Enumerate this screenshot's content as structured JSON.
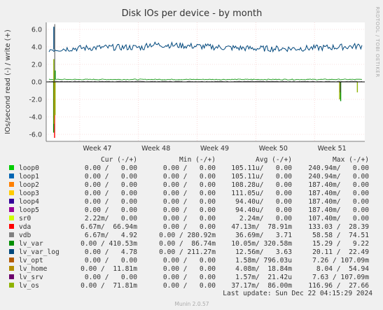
{
  "chart_data": {
    "type": "line",
    "title": "Disk IOs per device - by month",
    "ylabel": "IOs/second read (-) / write (+)",
    "xlabel": "",
    "ylim": [
      -6.8,
      6.8
    ],
    "yticks": [
      -6.0,
      -4.0,
      -2.0,
      0.0,
      2.0,
      4.0,
      6.0
    ],
    "ytick_labels": [
      "-6.0",
      "-4.0",
      "-2.0",
      "0.0",
      "2.0",
      "4.0",
      "6.0"
    ],
    "xlim": [
      "2024-11-14",
      "2024-12-22"
    ],
    "xticks": [
      {
        "label": "Week 47",
        "date": "2024-11-18"
      },
      {
        "label": "Week 48",
        "date": "2024-11-25"
      },
      {
        "label": "Week 49",
        "date": "2024-12-02"
      },
      {
        "label": "Week 50",
        "date": "2024-12-09"
      },
      {
        "label": "Week 51",
        "date": "2024-12-16"
      }
    ],
    "grid": true,
    "series": [
      {
        "name": "loop0",
        "color": "#00cc00",
        "approx_level": 0.0,
        "spikes": []
      },
      {
        "name": "loop1",
        "color": "#0066b3",
        "approx_level": 0.0,
        "spikes": []
      },
      {
        "name": "loop2",
        "color": "#ff8000",
        "approx_level": 0.0,
        "spikes": []
      },
      {
        "name": "loop3",
        "color": "#ffcc00",
        "approx_level": 0.0,
        "spikes": []
      },
      {
        "name": "loop4",
        "color": "#330099",
        "approx_level": 0.0,
        "spikes": []
      },
      {
        "name": "loop5",
        "color": "#990099",
        "approx_level": 0.0,
        "spikes": []
      },
      {
        "name": "sr0",
        "color": "#ccff00",
        "approx_level": 0.0,
        "spikes": []
      },
      {
        "name": "vda",
        "color": "#ff0000",
        "approx_level": 0.0,
        "spikes": [
          [
            "2024-11-15",
            -6.4
          ]
        ]
      },
      {
        "name": "vdb",
        "color": "#808080",
        "approx_level": 0.05,
        "spikes": [
          [
            "2024-11-15",
            6.6
          ]
        ]
      },
      {
        "name": "lv_var",
        "color": "#008f00",
        "approx_level": 0.28,
        "spikes": [
          [
            "2024-11-15",
            -5.8
          ],
          [
            "2024-11-15",
            1.3
          ],
          [
            "2024-12-19",
            -2.2
          ]
        ]
      },
      {
        "name": "lv_var_log",
        "color": "#00487d",
        "approx_level": 3.7,
        "spikes": [
          [
            "2024-11-15",
            6.3
          ]
        ]
      },
      {
        "name": "lv_opt",
        "color": "#b35a00",
        "approx_level": 0.0,
        "spikes": []
      },
      {
        "name": "lv_home",
        "color": "#b38f00",
        "approx_level": 0.0,
        "spikes": [
          [
            "2024-11-15",
            -4.8
          ]
        ]
      },
      {
        "name": "lv_srv",
        "color": "#6b006b",
        "approx_level": 0.0,
        "spikes": [
          [
            "2024-12-19",
            -1.2
          ]
        ]
      },
      {
        "name": "lv_os",
        "color": "#8fb300",
        "approx_level": 0.0,
        "spikes": [
          [
            "2024-11-15",
            2.6
          ],
          [
            "2024-11-15",
            -3.8
          ],
          [
            "2024-12-19",
            -2.0
          ],
          [
            "2024-12-21",
            -1.2
          ]
        ]
      }
    ]
  },
  "legend": {
    "headers": {
      "cur": "Cur (-/+)",
      "min": "Min (-/+)",
      "avg": "Avg (-/+)",
      "max": "Max (-/+)"
    },
    "rows": [
      {
        "name": "loop0",
        "color": "#00cc00",
        "cur": "0.00 /   0.00",
        "min": "0.00 /   0.00",
        "avg": "105.11u/   0.00",
        "max": "240.94m/   0.00"
      },
      {
        "name": "loop1",
        "color": "#0066b3",
        "cur": "0.00 /   0.00",
        "min": "0.00 /   0.00",
        "avg": "105.11u/   0.00",
        "max": "240.94m/   0.00"
      },
      {
        "name": "loop2",
        "color": "#ff8000",
        "cur": "0.00 /   0.00",
        "min": "0.00 /   0.00",
        "avg": "108.28u/   0.00",
        "max": "187.40m/   0.00"
      },
      {
        "name": "loop3",
        "color": "#ffcc00",
        "cur": "0.00 /   0.00",
        "min": "0.00 /   0.00",
        "avg": "111.05u/   0.00",
        "max": "187.40m/   0.00"
      },
      {
        "name": "loop4",
        "color": "#330099",
        "cur": "0.00 /   0.00",
        "min": "0.00 /   0.00",
        "avg": "94.40u/   0.00",
        "max": "187.40m/   0.00"
      },
      {
        "name": "loop5",
        "color": "#990099",
        "cur": "0.00 /   0.00",
        "min": "0.00 /   0.00",
        "avg": "94.40u/   0.00",
        "max": "187.40m/   0.00"
      },
      {
        "name": "sr0",
        "color": "#ccff00",
        "cur": "2.22m/   0.00",
        "min": "0.00 /   0.00",
        "avg": "2.24m/   0.00",
        "max": "107.40m/   0.00"
      },
      {
        "name": "vda",
        "color": "#ff0000",
        "cur": "6.67m/  66.94m",
        "min": "0.00 /   0.00",
        "avg": "47.13m/  78.91m",
        "max": "133.03 /  28.39"
      },
      {
        "name": "vdb",
        "color": "#808080",
        "cur": "6.67m/   4.92",
        "min": "0.00 / 280.92m",
        "avg": "36.69m/   3.71",
        "max": "58.58 /  74.51"
      },
      {
        "name": "lv_var",
        "color": "#008f00",
        "cur": "0.00 / 410.53m",
        "min": "0.00 /  86.74m",
        "avg": "10.05m/ 320.58m",
        "max": "15.29 /   9.22"
      },
      {
        "name": "lv_var_log",
        "color": "#00487d",
        "cur": "0.00 /   4.78",
        "min": "0.00 / 211.27m",
        "avg": "12.56m/   3.63",
        "max": "20.11 /  22.49"
      },
      {
        "name": "lv_opt",
        "color": "#b35a00",
        "cur": "0.00 /   0.00",
        "min": "0.00 /   0.00",
        "avg": "1.58m/ 796.03u",
        "max": "7.26 / 107.09m"
      },
      {
        "name": "lv_home",
        "color": "#b38f00",
        "cur": "0.00 /  11.81m",
        "min": "0.00 /   0.00",
        "avg": "4.08m/  18.84m",
        "max": "8.04 /  54.94"
      },
      {
        "name": "lv_srv",
        "color": "#6b006b",
        "cur": "0.00 /   0.00",
        "min": "0.00 /   0.00",
        "avg": "1.57m/  21.42u",
        "max": "7.63 / 107.09m"
      },
      {
        "name": "lv_os",
        "color": "#8fb300",
        "cur": "0.00 /  71.81m",
        "min": "0.00 /   0.00",
        "avg": "37.17m/  86.00m",
        "max": "116.96 /  27.66"
      }
    ]
  },
  "last_update": "Last update: Sun Dec 22 04:15:29 2024",
  "side_label": "RRDTOOL / TOBI OETIKER",
  "footer": "Munin 2.0.57"
}
